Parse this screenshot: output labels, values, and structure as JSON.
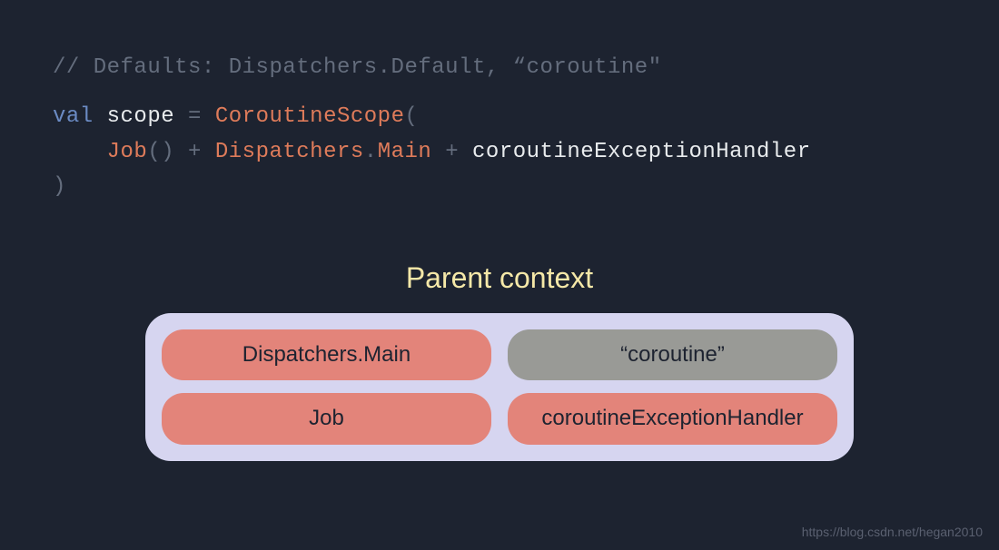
{
  "code": {
    "comment": "// Defaults: Dispatchers.Default, “coroutine\"",
    "line2_val": "val",
    "line2_scope": " scope ",
    "line2_eq": "=",
    "line2_ctor": " CoroutineScope",
    "line2_paren": "(",
    "line3_indent": "    ",
    "line3_job": "Job",
    "line3_p1": "()",
    "line3_plus1": " + ",
    "line3_disp": "Dispatchers",
    "line3_dot": ".",
    "line3_main": "Main",
    "line3_plus2": " + ",
    "line3_handler": "coroutineExceptionHandler",
    "line4_paren": ")"
  },
  "diagram": {
    "title": "Parent context",
    "pills": {
      "dispatchers": "Dispatchers.Main",
      "coroutine": "“coroutine”",
      "job": "Job",
      "handler": "coroutineExceptionHandler"
    }
  },
  "watermark": "https://blog.csdn.net/hegan2010"
}
